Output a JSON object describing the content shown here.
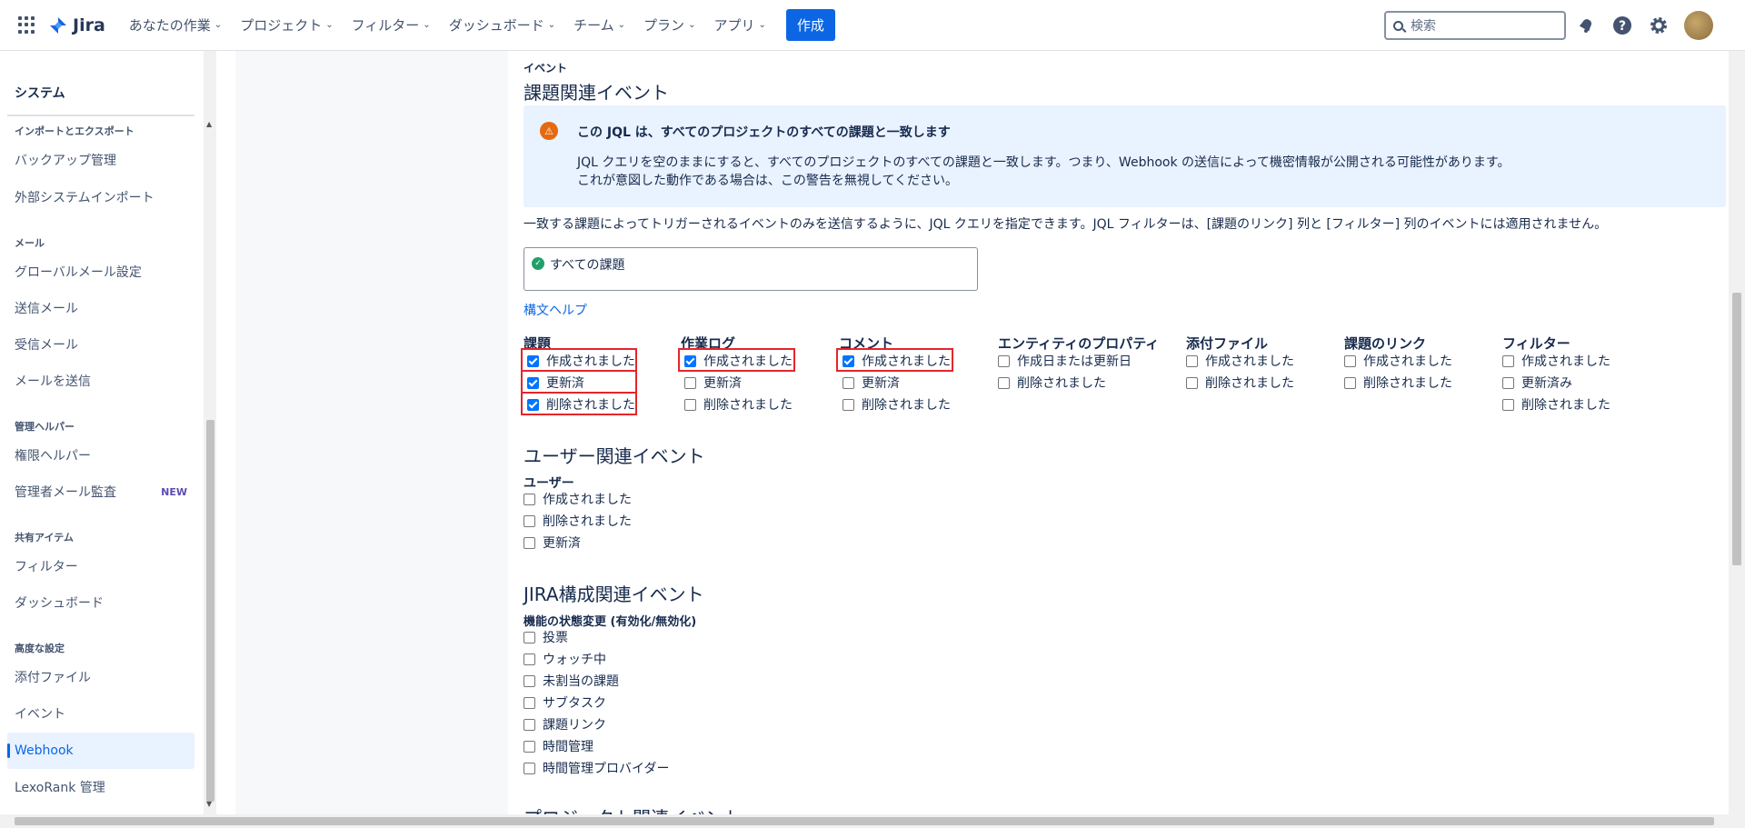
{
  "header": {
    "logo_text": "Jira",
    "nav": [
      "あなたの作業",
      "プロジェクト",
      "フィルター",
      "ダッシュボード",
      "チーム",
      "プラン",
      "アプリ"
    ],
    "create_label": "作成",
    "search_placeholder": "検索"
  },
  "sidebar": {
    "title": "システム",
    "sections": [
      {
        "label": "インポートとエクスポート",
        "items": [
          "バックアップ管理",
          "外部システムインポート"
        ]
      },
      {
        "label": "メール",
        "items": [
          "グローバルメール設定",
          "送信メール",
          "受信メール",
          "メールを送信"
        ]
      },
      {
        "label": "管理ヘルパー",
        "items": [
          "権限ヘルパー",
          "管理者メール監査"
        ]
      },
      {
        "label": "共有アイテム",
        "items": [
          "フィルター",
          "ダッシュボード"
        ]
      },
      {
        "label": "高度な設定",
        "items": [
          "添付ファイル",
          "イベント",
          "Webhook",
          "LexoRank 管理"
        ]
      }
    ],
    "new_badge": "NEW",
    "active_item": "Webhook"
  },
  "main": {
    "events_label": "イベント",
    "issue_events_title": "課題関連イベント",
    "banner": {
      "title": "この JQL は、すべてのプロジェクトのすべての課題と一致します",
      "line1": "JQL クエリを空のままにすると、すべてのプロジェクトのすべての課題と一致します。つまり、Webhook の送信によって機密情報が公開される可能性があります。",
      "line2": "これが意図した動作である場合は、この警告を無視してください。"
    },
    "description": "一致する課題によってトリガーされるイベントのみを送信するように、JQL クエリを指定できます。JQL フィルターは、[課題のリンク] 列と [フィルター] 列のイベントには適用されません。",
    "jql_value": "すべての課題",
    "syntax_help": "構文ヘルプ",
    "columns": [
      {
        "title": "課題",
        "options": [
          {
            "label": "作成されました",
            "checked": true
          },
          {
            "label": "更新済",
            "checked": true
          },
          {
            "label": "削除されました",
            "checked": true
          }
        ]
      },
      {
        "title": "作業ログ",
        "options": [
          {
            "label": "作成されました",
            "checked": true
          },
          {
            "label": "更新済",
            "checked": false
          },
          {
            "label": "削除されました",
            "checked": false
          }
        ]
      },
      {
        "title": "コメント",
        "options": [
          {
            "label": "作成されました",
            "checked": true
          },
          {
            "label": "更新済",
            "checked": false
          },
          {
            "label": "削除されました",
            "checked": false
          }
        ]
      },
      {
        "title": "エンティティのプロパティ",
        "options": [
          {
            "label": "作成日または更新日",
            "checked": false
          },
          {
            "label": "削除されました",
            "checked": false
          }
        ]
      },
      {
        "title": "添付ファイル",
        "options": [
          {
            "label": "作成されました",
            "checked": false
          },
          {
            "label": "削除されました",
            "checked": false
          }
        ]
      },
      {
        "title": "課題のリンク",
        "options": [
          {
            "label": "作成されました",
            "checked": false
          },
          {
            "label": "削除されました",
            "checked": false
          }
        ]
      },
      {
        "title": "フィルター",
        "options": [
          {
            "label": "作成されました",
            "checked": false
          },
          {
            "label": "更新済み",
            "checked": false
          },
          {
            "label": "削除されました",
            "checked": false
          }
        ]
      }
    ],
    "user_events_title": "ユーザー関連イベント",
    "user_sub": "ユーザー",
    "user_options": [
      "作成されました",
      "削除されました",
      "更新済"
    ],
    "jira_events_title": "JIRA構成関連イベント",
    "feature_sub": "機能の状態変更 (有効化/無効化)",
    "feature_options": [
      "投票",
      "ウォッチ中",
      "未割当の課題",
      "サブタスク",
      "課題リンク",
      "時間管理",
      "時間管理プロバイダー"
    ],
    "cut_title": "プロジェクト関連イベント"
  },
  "colors": {
    "accent": "#0c66e4",
    "highlight": "#e5252a",
    "banner_bg": "#e9f2ff",
    "warn": "#e56910"
  }
}
